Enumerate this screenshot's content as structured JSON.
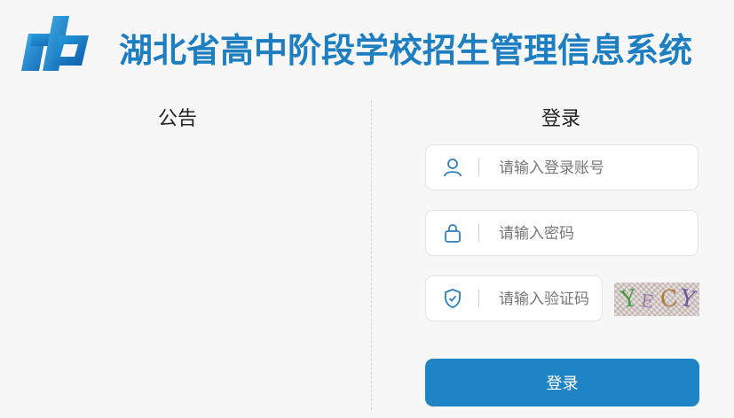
{
  "header": {
    "title": "湖北省高中阶段学校招生管理信息系统"
  },
  "notice": {
    "title": "公告"
  },
  "login": {
    "title": "登录",
    "username_placeholder": "请输入登录账号",
    "password_placeholder": "请输入密码",
    "captcha_placeholder": "请输入验证码",
    "captcha_text": [
      "Y",
      "E",
      "C",
      "Y"
    ],
    "submit_label": "登录"
  },
  "colors": {
    "brand": "#1d7ec2",
    "button": "#1f84c6",
    "icon": "#2b7fc1"
  },
  "icons": {
    "logo": "logo-mark",
    "username": "user-icon",
    "password": "lock-icon",
    "captcha": "shield-check-icon"
  }
}
